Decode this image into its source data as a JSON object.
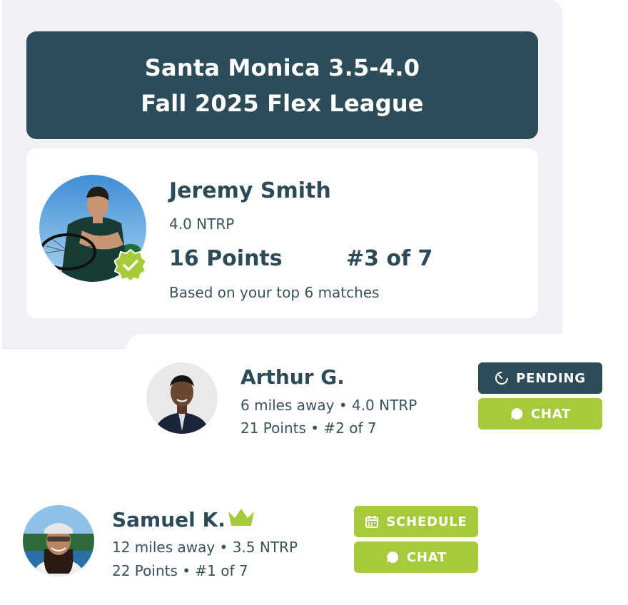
{
  "league": {
    "title_line1": "Santa Monica 3.5-4.0",
    "title_line2": "Fall 2025 Flex League"
  },
  "me": {
    "name": "Jeremy Smith",
    "rating": "4.0 NTRP",
    "points": "16 Points",
    "rank": "#3 of 7",
    "basis": "Based on your top 6 matches",
    "verified": true
  },
  "players": [
    {
      "name": "Arthur G.",
      "distance_rating": "6 miles away • 4.0 NTRP",
      "points_rank": "21 Points • #2 of 7",
      "buttons": [
        {
          "label": "PENDING",
          "icon": "timer-icon",
          "color": "#2c4c59"
        },
        {
          "label": "CHAT",
          "icon": "chat-bubble-icon",
          "color": "#a5cb3a"
        }
      ]
    },
    {
      "name": "Samuel K.",
      "badge": "crown-icon",
      "distance_rating": "12 miles away • 3.5 NTRP",
      "points_rank": "22 Points • #1 of 7",
      "buttons": [
        {
          "label": "SCHEDULE",
          "icon": "calendar-icon",
          "color": "#a5cb3a"
        },
        {
          "label": "CHAT",
          "icon": "chat-bubble-icon",
          "color": "#a5cb3a"
        }
      ]
    }
  ],
  "colors": {
    "primary_dark": "#2c4c59",
    "accent_green": "#a5cb3a",
    "panel_bg": "#f0f0f6",
    "crown": "#a5cb3a"
  }
}
